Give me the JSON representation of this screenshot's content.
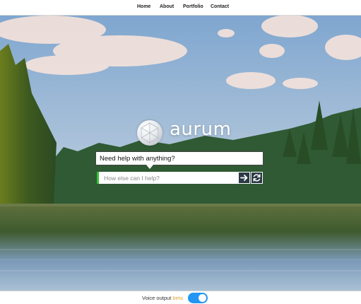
{
  "nav": {
    "home": "Home",
    "about": "About",
    "portfolio": "Portfolio",
    "contact": "Contact"
  },
  "brand": {
    "name": "aurum",
    "logo_icon": "globe-logo-icon"
  },
  "assistant": {
    "prompt": "Need help with anything?",
    "input_placeholder": "How else can I help?",
    "input_value": "",
    "send_icon": "arrow-right-icon",
    "refresh_icon": "refresh-icon"
  },
  "footer": {
    "voice_label": "Voice output",
    "voice_badge": "beta",
    "voice_enabled": true
  },
  "colors": {
    "input_accent": "#35c13a",
    "button_bg": "#2c3a46",
    "toggle_on": "#2196f3",
    "beta": "#e2a43a"
  }
}
